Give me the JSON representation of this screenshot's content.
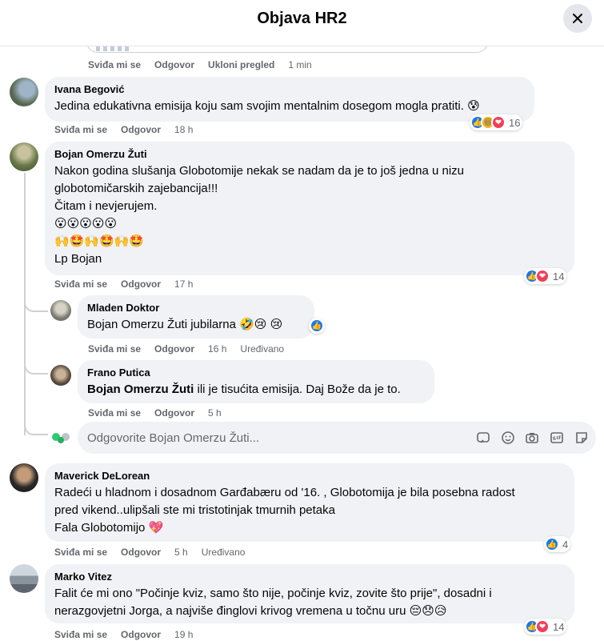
{
  "header": {
    "title": "Objava HR2"
  },
  "top_actions": {
    "like": "Sviđa mi se",
    "reply": "Odgovor",
    "remove_preview": "Ukloni pregled",
    "time": "1 min"
  },
  "comments": [
    {
      "name": "Ivana Begović",
      "lines": [
        "Jedina edukativna emisija koju sam svojim mentalnim dosegom mogla pratiti. 😰"
      ],
      "like": "Sviđa mi se",
      "reply": "Odgovor",
      "time": "18 h",
      "reaction_count": "16"
    },
    {
      "name": "Bojan Omerzu Žuti",
      "lines": [
        "Nakon godina slušanja Globotomije nekak se nadam da je to još jedna u nizu",
        "globotomičarskih zajebancija!!!",
        "Čitam i nevjerujem.",
        "😮😮😮😮😮",
        "🙌🤩🙌🤩🙌🤩",
        "Lp Bojan"
      ],
      "like": "Sviđa mi se",
      "reply": "Odgovor",
      "time": "17 h",
      "reaction_count": "14"
    },
    {
      "name": "Maverick DeLorean",
      "lines": [
        "Radeći u hladnom i dosadnom Garđabæru od '16. , Globotomija je bila posebna radost",
        "pred vikend..ulipšali ste mi tristotinjak tmurnih petaka",
        "Fala Globotomijo 💖"
      ],
      "like": "Sviđa mi se",
      "reply": "Odgovor",
      "time": "5 h",
      "edited": "Uređivano",
      "reaction_count": "4"
    },
    {
      "name": "Marko Vitez",
      "lines": [
        "Falit će mi ono \"Počinje kviz, samo što nije, počinje kviz, zovite što prije\", dosadni i",
        "nerazgovjetni Jorga, a najviše đinglovi krivog vremena u točnu uru 😔😞😥"
      ],
      "like": "Sviđa mi se",
      "reply": "Odgovor",
      "time": "19 h",
      "reaction_count": "14"
    }
  ],
  "replies": [
    {
      "name": "Mladen Doktor",
      "text": "Bojan Omerzu Žuti jubilarna 🤣😢 😢",
      "like": "Sviđa mi se",
      "reply": "Odgovor",
      "time": "16 h",
      "edited": "Uređivano"
    },
    {
      "name": "Frano Putica",
      "tag": "Bojan Omerzu Žuti",
      "text": " ili je tisućita emisija. Daj Bože da je to.",
      "like": "Sviđa mi se",
      "reply": "Odgovor",
      "time": "5 h"
    }
  ],
  "reply_input": {
    "placeholder": "Odgovorite Bojan Omerzu Žuti..."
  },
  "colors": {
    "like_blue": "#1877f2",
    "love_red": "#f33e58",
    "bubble_bg": "#f0f2f5",
    "meta_gray": "#65676b"
  }
}
